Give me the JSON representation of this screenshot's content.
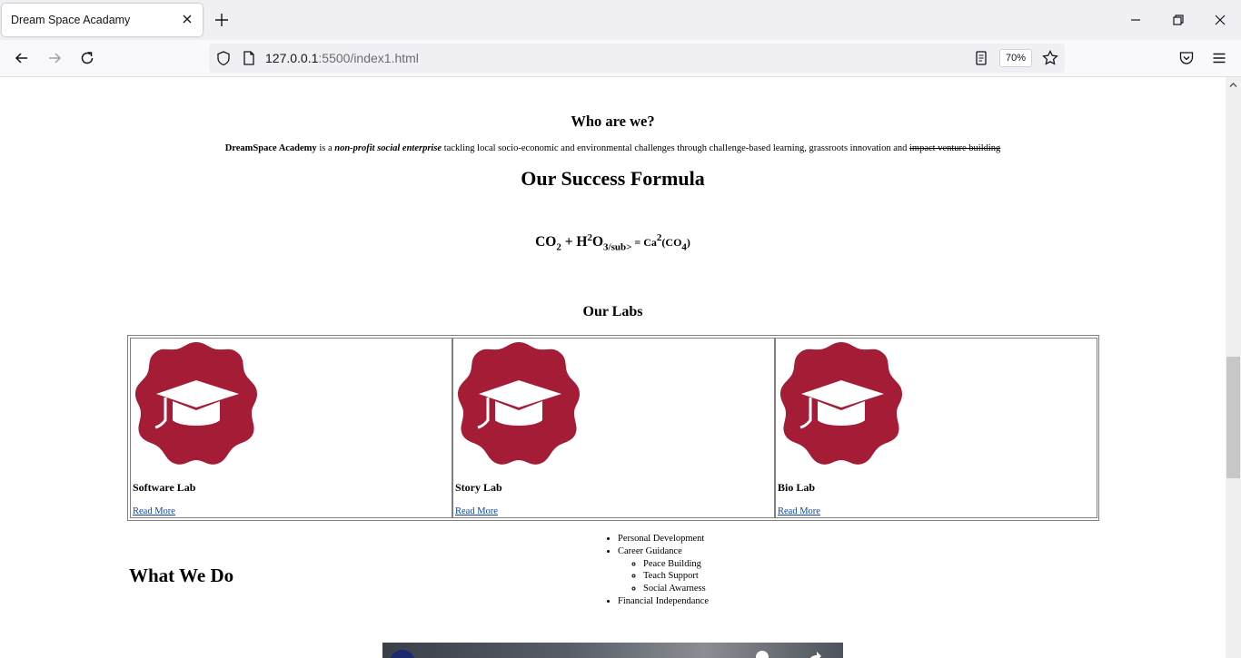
{
  "browser": {
    "tab_title": "Dream Space Acadamy",
    "url_host": "127.0.0.1",
    "url_rest": ":5500/index1.html",
    "zoom": "70%"
  },
  "page": {
    "who_heading": "Who are we?",
    "about": {
      "org_name": "DreamSpace Academy",
      "is_a": " is a ",
      "kind": "non-profit social enterprise",
      "body": " tackling local socio-economic and environmental challenges through challenge-based learning, grassroots innovation and ",
      "struck": "impact venture building"
    },
    "formula_heading": "Our Success Formula",
    "formula": {
      "co": "CO",
      "co_sub": "2",
      "plus": " + H",
      "h_sup": "2",
      "o": "O",
      "o_sub": "3/sub>",
      "eq": " = Ca",
      "ca_sup": "2",
      "paren_open": "(CO",
      "co4_sub": "4",
      "paren_close": ")"
    },
    "labs_heading": "Our Labs",
    "labs": [
      {
        "name": "Software Lab",
        "link": "Read More"
      },
      {
        "name": "Story Lab",
        "link": "Read More"
      },
      {
        "name": "Bio Lab",
        "link": "Read More"
      }
    ],
    "what_we_do": "What We Do",
    "services": {
      "personal": "Personal Development",
      "career": "Career Guidance",
      "sub": [
        "Peace Building",
        "Teach Support",
        "Social Awarness"
      ],
      "financial": "Financial Independance"
    }
  },
  "colors": {
    "badge": "#a51c37",
    "link": "#0645ad"
  },
  "icons": [
    "back-icon",
    "forward-icon",
    "reload-icon",
    "shield-icon",
    "page-icon",
    "reader-icon",
    "bookmark-star-icon",
    "pocket-icon",
    "menu-icon",
    "graduation-cap-icon"
  ]
}
